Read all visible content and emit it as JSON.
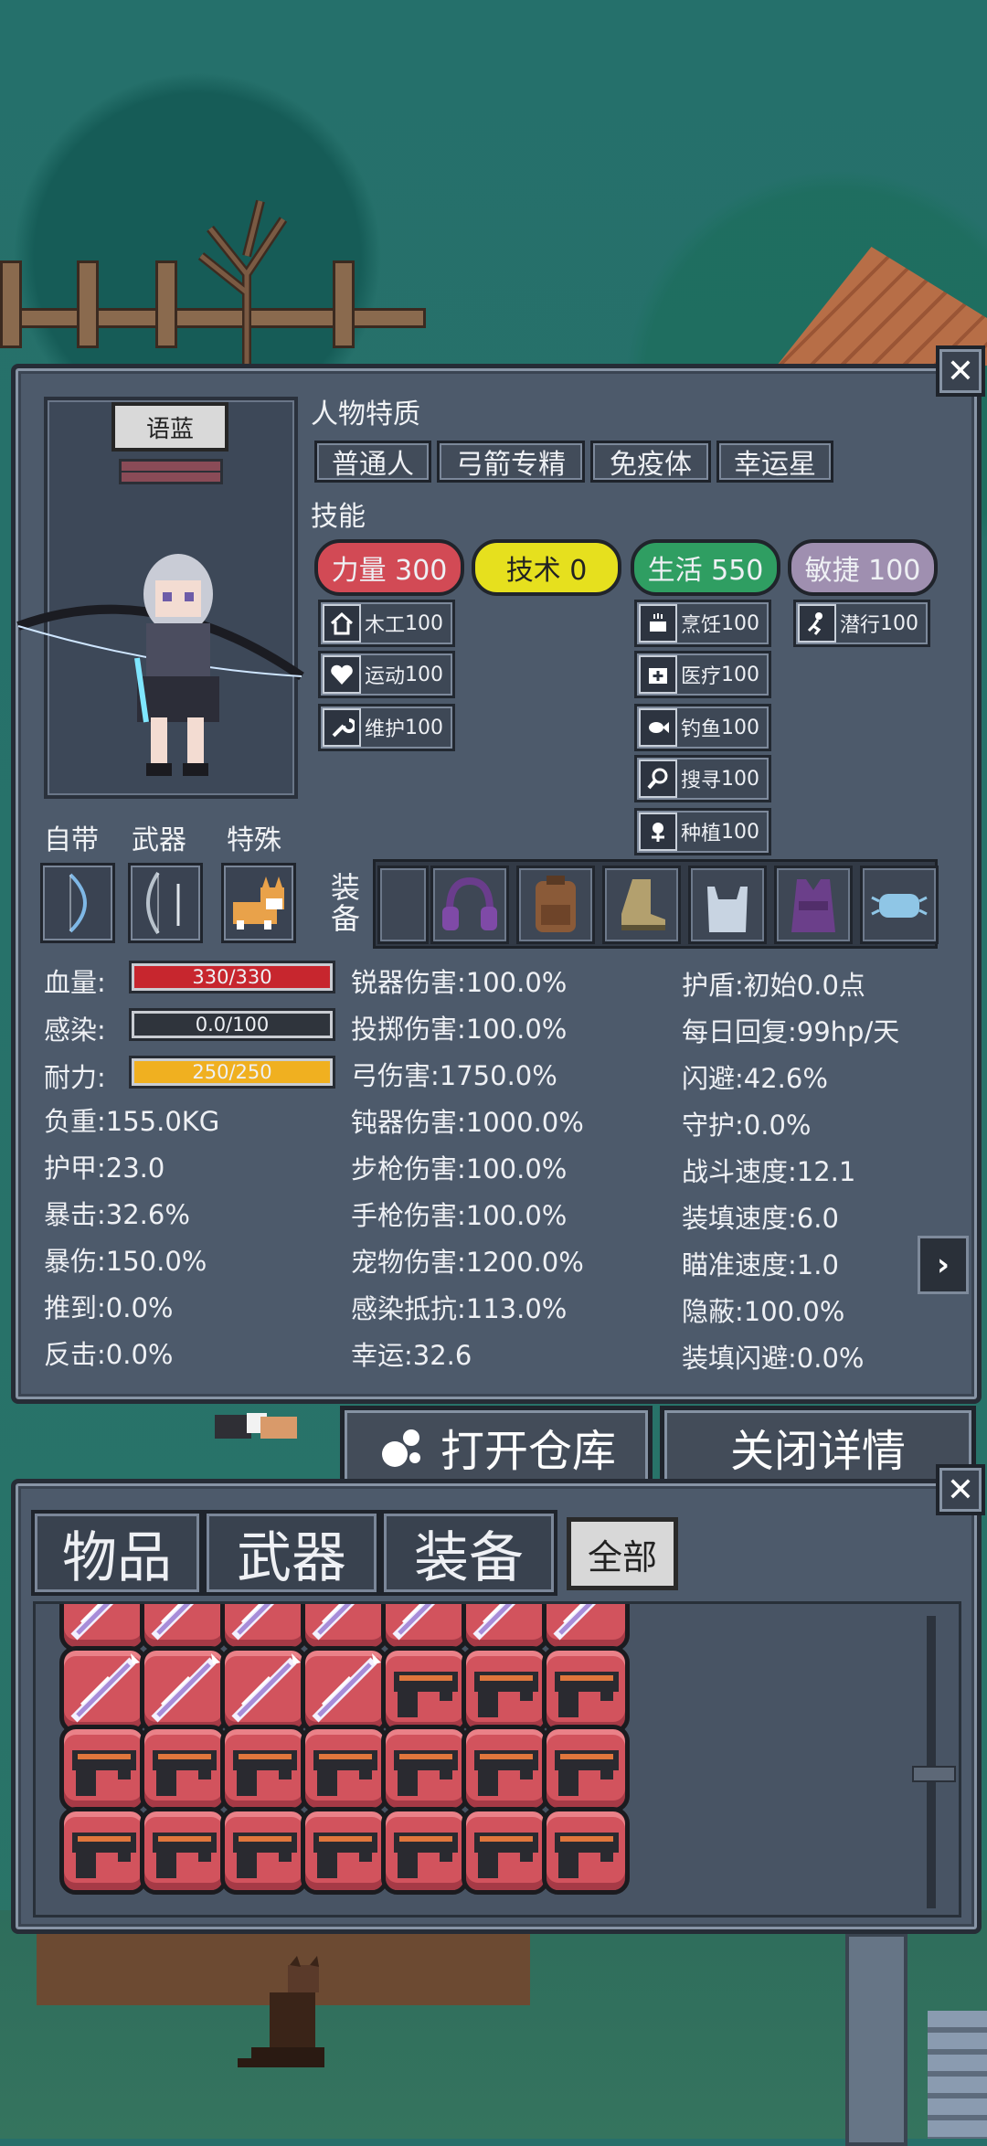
{
  "character": {
    "name": "语蓝"
  },
  "sections": {
    "traits": "人物特质",
    "skills": "技能",
    "equip": "装备"
  },
  "traits": [
    "普通人",
    "弓箭专精",
    "免疫体",
    "幸运星"
  ],
  "attributes": [
    {
      "label": "力量 300",
      "color": "#d24a55"
    },
    {
      "label": "技术 0",
      "color": "#e6e01e"
    },
    {
      "label": "生活 550",
      "color": "#2f9e62"
    },
    {
      "label": "敏捷 100",
      "color": "#9f8fb0"
    }
  ],
  "skills": {
    "strength": [
      {
        "name": "木工",
        "value": "100",
        "icon": "house-icon"
      },
      {
        "name": "运动",
        "value": "100",
        "icon": "heart-icon"
      },
      {
        "name": "维护",
        "value": "100",
        "icon": "wrench-icon"
      }
    ],
    "life": [
      {
        "name": "烹饪",
        "value": "100",
        "icon": "pot-icon"
      },
      {
        "name": "医疗",
        "value": "100",
        "icon": "medkit-icon"
      },
      {
        "name": "钓鱼",
        "value": "100",
        "icon": "fish-icon"
      },
      {
        "name": "搜寻",
        "value": "100",
        "icon": "magnifier-icon"
      },
      {
        "name": "种植",
        "value": "100",
        "icon": "plant-icon"
      }
    ],
    "agility": [
      {
        "name": "潜行",
        "value": "100",
        "icon": "sneak-icon"
      }
    ]
  },
  "slot_labels": {
    "carry": "自带",
    "weapon": "武器",
    "special": "特殊"
  },
  "equipment": [
    "empty-slot",
    "headphones-icon",
    "backpack-icon",
    "boots-icon",
    "plastic-bag-icon",
    "vest-icon",
    "face-mask-icon"
  ],
  "bars": {
    "hp": {
      "label": "血量:",
      "text": "330/330",
      "fill": 1.0,
      "color": "#c7262e"
    },
    "infection": {
      "label": "感染:",
      "text": "0.0/100",
      "fill": 0.0,
      "color": "#2f343c"
    },
    "stamina": {
      "label": "耐力:",
      "text": "250/250",
      "fill": 1.0,
      "color": "#f0b020"
    }
  },
  "stats_left": [
    "负重:155.0KG",
    "护甲:23.0",
    "暴击:32.6%",
    "暴伤:150.0%",
    "推到:0.0%",
    "反击:0.0%"
  ],
  "stats_mid": [
    "锐器伤害:100.0%",
    "投掷伤害:100.0%",
    "弓伤害:1750.0%",
    "钝器伤害:1000.0%",
    "步枪伤害:100.0%",
    "手枪伤害:100.0%",
    "宠物伤害:1200.0%",
    "感染抵抗:113.0%",
    "幸运:32.6"
  ],
  "stats_right": [
    "护盾:初始0.0点",
    "每日回复:99hp/天",
    "闪避:42.6%",
    "守护:0.0%",
    "战斗速度:12.1",
    "装填速度:6.0",
    "瞄准速度:1.0",
    "隐蔽:100.0%",
    "装填闪避:0.0%"
  ],
  "buttons": {
    "open_storage": "打开仓库",
    "close_details": "关闭详情",
    "close": "✕",
    "next": "›"
  },
  "tabs": {
    "items": "物品",
    "weapons": "武器",
    "equipment": "装备",
    "all": "全部"
  },
  "inventory_rows": [
    [
      "throwing-knife-icon",
      "throwing-knife-icon",
      "throwing-knife-icon",
      "throwing-knife-icon",
      "throwing-knife-icon",
      "throwing-knife-icon",
      "throwing-knife-icon"
    ],
    [
      "throwing-knife-icon",
      "throwing-knife-icon",
      "throwing-knife-icon",
      "throwing-knife-icon",
      "pistol-icon",
      "pistol-icon",
      "pistol-icon"
    ],
    [
      "pistol-icon",
      "pistol-icon",
      "pistol-icon",
      "pistol-icon",
      "pistol-icon",
      "pistol-icon",
      "pistol-icon"
    ],
    [
      "pistol-icon",
      "pistol-icon",
      "pistol-icon",
      "pistol-icon",
      "pistol-icon",
      "pistol-icon",
      "pistol-icon"
    ]
  ]
}
